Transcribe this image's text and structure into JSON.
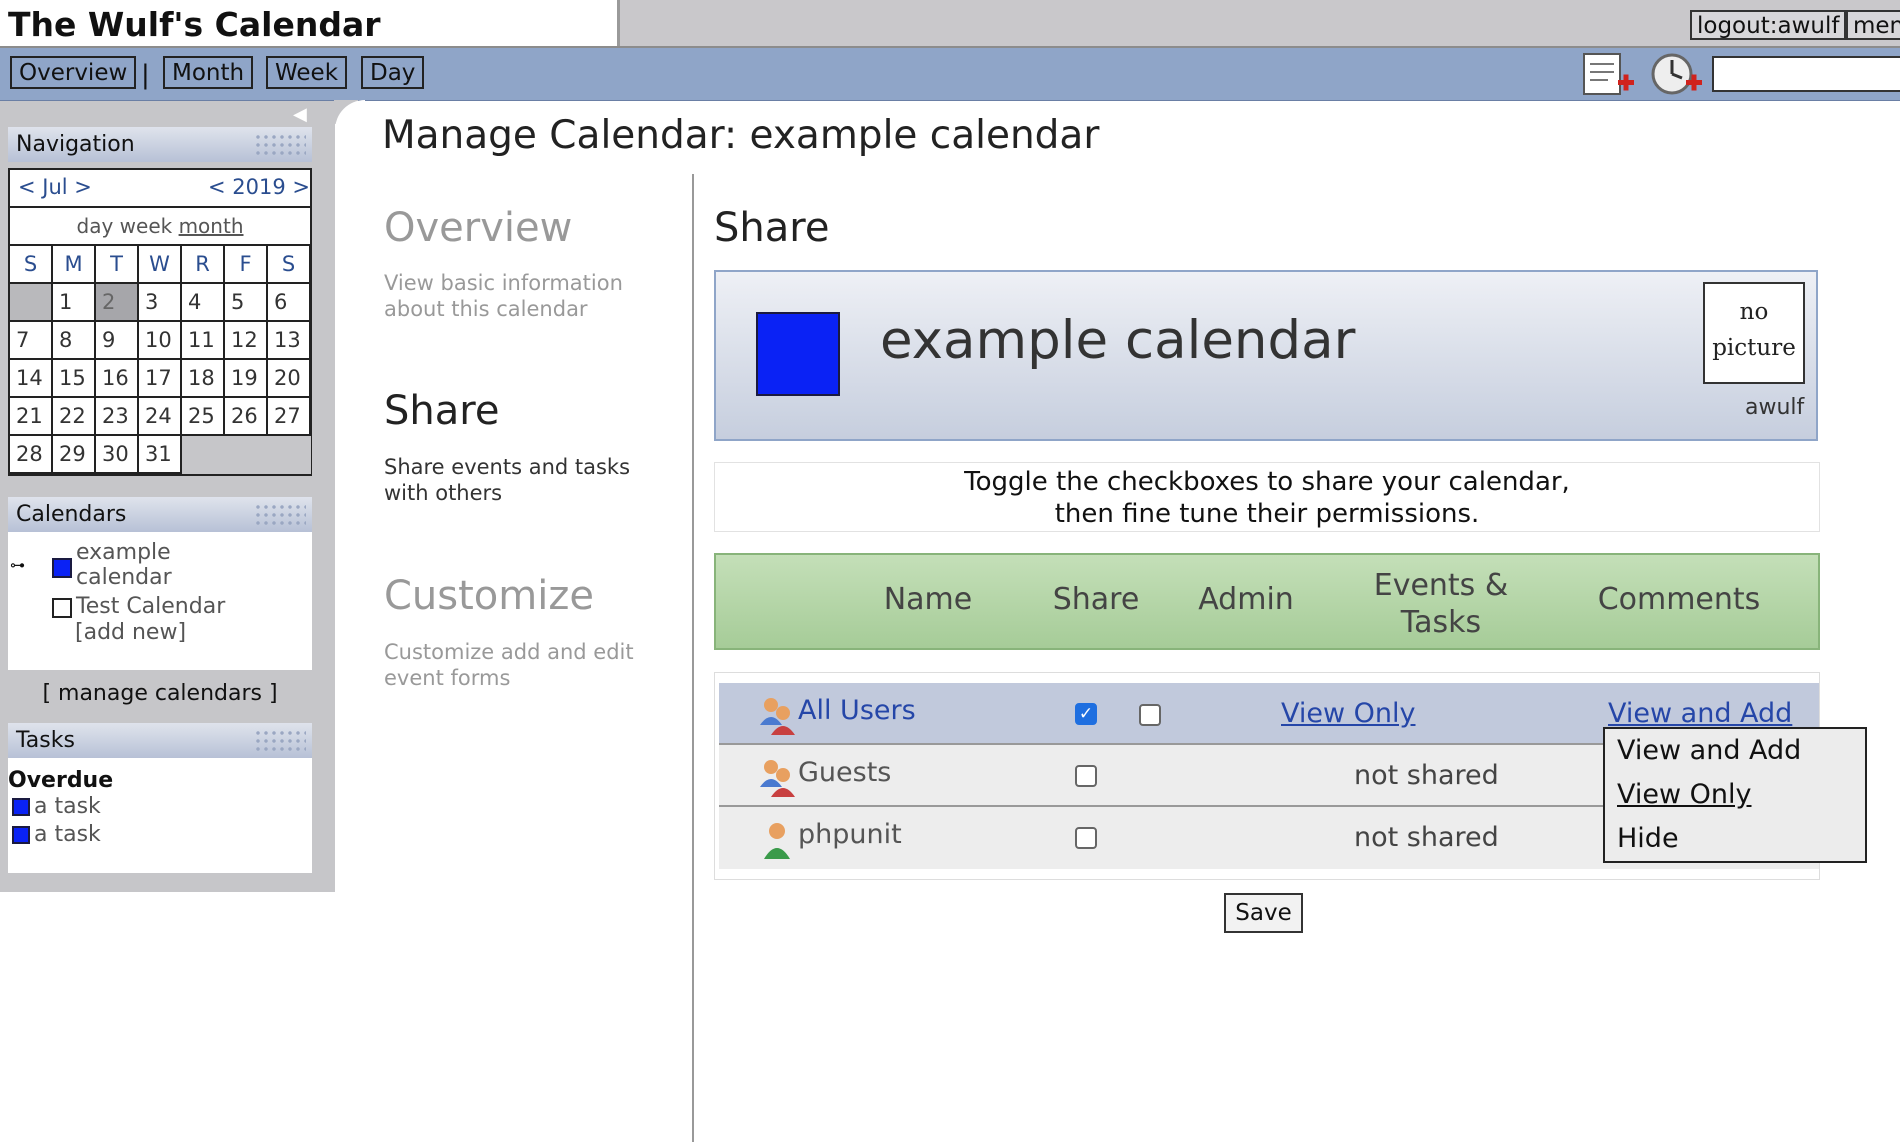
{
  "app": {
    "title": "The Wulf's Calendar"
  },
  "topbar": {
    "logout_label": "logout:awulf",
    "menu_label": "men"
  },
  "navbar": {
    "overview": "Overview",
    "separator": "|",
    "month": "Month",
    "week": "Week",
    "day": "Day"
  },
  "sidebar": {
    "navigation": {
      "title": "Navigation",
      "month_label": "< Jul >",
      "year_label": "< 2019 >",
      "views": {
        "day": "day",
        "week": "week",
        "month": "month"
      },
      "weekdays": [
        "S",
        "M",
        "T",
        "W",
        "R",
        "F",
        "S"
      ],
      "weeks": [
        [
          "",
          "1",
          "2",
          "3",
          "4",
          "5",
          "6"
        ],
        [
          "7",
          "8",
          "9",
          "10",
          "11",
          "12",
          "13"
        ],
        [
          "14",
          "15",
          "16",
          "17",
          "18",
          "19",
          "20"
        ],
        [
          "21",
          "22",
          "23",
          "24",
          "25",
          "26",
          "27"
        ],
        [
          "28",
          "29",
          "30",
          "31",
          "",
          "",
          ""
        ]
      ],
      "today": "2"
    },
    "calendars": {
      "title": "Calendars",
      "items": [
        {
          "label": "example calendar",
          "color": "#0a22f5",
          "checked": true
        },
        {
          "label": "Test Calendar",
          "color": "#ffffff",
          "checked": false
        }
      ],
      "add_new": "[add new]",
      "manage": "[ manage calendars ]"
    },
    "tasks": {
      "title": "Tasks",
      "group": "Overdue",
      "items": [
        "a task",
        "a task"
      ]
    }
  },
  "main": {
    "title": "Manage Calendar: example calendar",
    "sections": [
      {
        "title": "Overview",
        "desc": "View basic information about this calendar",
        "active": false
      },
      {
        "title": "Share",
        "desc": "Share events and tasks with others",
        "active": true
      },
      {
        "title": "Customize",
        "desc": "Customize add and edit event forms",
        "active": false
      }
    ],
    "share": {
      "heading": "Share",
      "calendar_name": "example calendar",
      "calendar_color": "#0a22f5",
      "no_picture_line1": "no",
      "no_picture_line2": "picture",
      "owner": "awulf",
      "instructions_line1": "Toggle the checkboxes to share your calendar,",
      "instructions_line2": "then fine tune their permissions.",
      "columns": {
        "name": "Name",
        "share": "Share",
        "admin": "Admin",
        "events_line1": "Events &",
        "events_line2": "Tasks",
        "comments": "Comments"
      },
      "rows": [
        {
          "name": "All Users",
          "share": true,
          "admin": false,
          "events": "View Only",
          "comments": "View and Add"
        },
        {
          "name": "Guests",
          "share": false,
          "status": "not shared"
        },
        {
          "name": "phpunit",
          "share": false,
          "status": "not shared"
        }
      ],
      "comments_dropdown": {
        "options": [
          "View and Add",
          "View Only",
          "Hide"
        ],
        "highlighted": "View Only"
      },
      "save_label": "Save"
    }
  }
}
